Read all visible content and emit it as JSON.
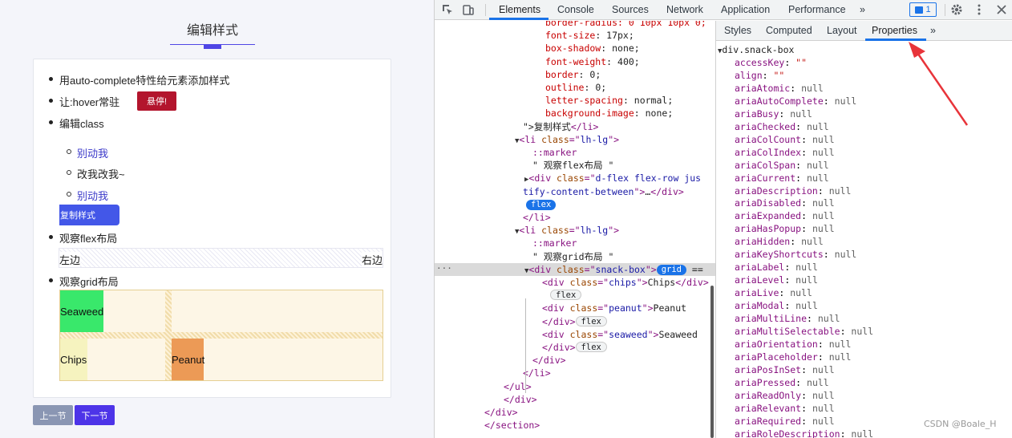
{
  "page": {
    "title": "编辑样式",
    "items": [
      "用auto-complete特性给元素添加样式",
      "让:hover常驻",
      "编辑class",
      "观察flex布局",
      "观察grid布局"
    ],
    "hover_button": "悬停!",
    "sub_items": [
      "别动我",
      "改我改我~",
      "别动我"
    ],
    "snack_button": "复制样式",
    "flex_left": "左边",
    "flex_right": "右边",
    "grid": {
      "seaweed": "Seaweed",
      "chips": "Chips",
      "peanut": "Peanut"
    },
    "prev": "上一节",
    "next": "下一节"
  },
  "devtools": {
    "tabs": [
      "Elements",
      "Console",
      "Sources",
      "Network",
      "Application",
      "Performance",
      "»"
    ],
    "issues_count": "1",
    "side_tabs": [
      "Styles",
      "Computed",
      "Layout",
      "Properties",
      "»"
    ],
    "dom_lines": [
      {
        "parts": [
          [
            "p",
            "border-radius: 0 10px 10px 0;"
          ]
        ]
      },
      {
        "parts": [
          [
            "p",
            "font-size"
          ],
          [
            "pv",
            ": 17px;"
          ]
        ]
      },
      {
        "parts": [
          [
            "p",
            "box-shadow"
          ],
          [
            "pv",
            ": none;"
          ]
        ]
      },
      {
        "parts": [
          [
            "p",
            "font-weight"
          ],
          [
            "pv",
            ": 400;"
          ]
        ]
      },
      {
        "parts": [
          [
            "p",
            "border"
          ],
          [
            "pv",
            ": 0;"
          ]
        ]
      },
      {
        "parts": [
          [
            "p",
            "outline"
          ],
          [
            "pv",
            ": 0;"
          ]
        ]
      },
      {
        "parts": [
          [
            "p",
            "letter-spacing"
          ],
          [
            "pv",
            ": normal;"
          ]
        ]
      },
      {
        "parts": [
          [
            "p",
            "background-image"
          ],
          [
            "pv",
            ": none;"
          ]
        ]
      },
      {
        "parts": [
          [
            "pv",
            "\">复制样式"
          ],
          [
            "t",
            "</li>"
          ]
        ]
      },
      {
        "parts": [
          [
            "tri",
            "▼"
          ],
          [
            "t",
            "<li "
          ],
          [
            "a",
            "class"
          ],
          [
            "t",
            "=\""
          ],
          [
            "v",
            "lh-lg"
          ],
          [
            "t",
            "\">"
          ]
        ]
      },
      {
        "parts": [
          [
            "ps",
            "::marker"
          ]
        ]
      },
      {
        "parts": [
          [
            "pv",
            "\" 观察flex布局 \""
          ]
        ]
      },
      {
        "parts": [
          [
            "tri",
            "▶"
          ],
          [
            "t",
            "<div "
          ],
          [
            "a",
            "class"
          ],
          [
            "t",
            "=\""
          ],
          [
            "v",
            "d-flex flex-row jus"
          ]
        ]
      },
      {
        "parts": [
          [
            "v",
            "tify-content-between"
          ],
          [
            "t",
            "\">"
          ],
          [
            "pv",
            "…"
          ],
          [
            "t",
            "</div>"
          ]
        ]
      },
      {
        "parts": [
          [
            "badge-on",
            "flex"
          ]
        ]
      },
      {
        "parts": [
          [
            "t",
            "</li>"
          ]
        ]
      },
      {
        "parts": [
          [
            "tri",
            "▼"
          ],
          [
            "t",
            "<li "
          ],
          [
            "a",
            "class"
          ],
          [
            "t",
            "=\""
          ],
          [
            "v",
            "lh-lg"
          ],
          [
            "t",
            "\">"
          ]
        ]
      },
      {
        "parts": [
          [
            "ps",
            "::marker"
          ]
        ]
      },
      {
        "parts": [
          [
            "pv",
            "\" 观察grid布局 \""
          ]
        ]
      },
      {
        "parts": [
          [
            "tri",
            "▼"
          ],
          [
            "t",
            "<div "
          ],
          [
            "a",
            "class"
          ],
          [
            "t",
            "=\""
          ],
          [
            "v",
            "snack-box"
          ],
          [
            "t",
            "\">"
          ],
          [
            "badge-on",
            "grid"
          ],
          [
            "pv",
            " =="
          ]
        ]
      },
      {
        "parts": [
          [
            "t",
            "<div "
          ],
          [
            "a",
            "class"
          ],
          [
            "t",
            "=\""
          ],
          [
            "v",
            "chips"
          ],
          [
            "t",
            "\">"
          ],
          [
            "pv",
            "Chips"
          ],
          [
            "t",
            "</div>"
          ]
        ]
      },
      {
        "parts": [
          [
            "badge-off",
            "flex"
          ]
        ]
      },
      {
        "parts": [
          [
            "t",
            "<div "
          ],
          [
            "a",
            "class"
          ],
          [
            "t",
            "=\""
          ],
          [
            "v",
            "peanut"
          ],
          [
            "t",
            "\">"
          ],
          [
            "pv",
            "Peanut"
          ]
        ]
      },
      {
        "parts": [
          [
            "t",
            "</div>"
          ],
          [
            "badge-off",
            "flex"
          ]
        ]
      },
      {
        "parts": [
          [
            "t",
            "<div "
          ],
          [
            "a",
            "class"
          ],
          [
            "t",
            "=\""
          ],
          [
            "v",
            "seaweed"
          ],
          [
            "t",
            "\">"
          ],
          [
            "pv",
            "Seaweed"
          ]
        ]
      },
      {
        "parts": [
          [
            "t",
            "</div>"
          ],
          [
            "badge-off",
            "flex"
          ]
        ]
      },
      {
        "parts": [
          [
            "t",
            "</div>"
          ]
        ]
      },
      {
        "parts": [
          [
            "t",
            "</li>"
          ]
        ]
      },
      {
        "parts": [
          [
            "t",
            "</ul>"
          ]
        ]
      },
      {
        "parts": [
          [
            "t",
            "</div>"
          ]
        ]
      },
      {
        "parts": [
          [
            "t",
            "</div>"
          ]
        ]
      },
      {
        "parts": [
          [
            "t",
            "</section>"
          ]
        ]
      }
    ],
    "dom_indent": [
      138,
      138,
      138,
      138,
      138,
      138,
      138,
      138,
      110,
      100,
      122,
      122,
      112,
      110,
      114,
      110,
      100,
      122,
      122,
      112,
      134,
      144,
      134,
      134,
      134,
      134,
      122,
      110,
      86,
      86,
      62,
      62
    ],
    "dom_selected": 19,
    "props_head": "div.snack-box",
    "props": [
      [
        "accessKey",
        "\"\"",
        "s"
      ],
      [
        "align",
        "\"\"",
        "s"
      ],
      [
        "ariaAtomic",
        "null",
        "n"
      ],
      [
        "ariaAutoComplete",
        "null",
        "n"
      ],
      [
        "ariaBusy",
        "null",
        "n"
      ],
      [
        "ariaChecked",
        "null",
        "n"
      ],
      [
        "ariaColCount",
        "null",
        "n"
      ],
      [
        "ariaColIndex",
        "null",
        "n"
      ],
      [
        "ariaColSpan",
        "null",
        "n"
      ],
      [
        "ariaCurrent",
        "null",
        "n"
      ],
      [
        "ariaDescription",
        "null",
        "n"
      ],
      [
        "ariaDisabled",
        "null",
        "n"
      ],
      [
        "ariaExpanded",
        "null",
        "n"
      ],
      [
        "ariaHasPopup",
        "null",
        "n"
      ],
      [
        "ariaHidden",
        "null",
        "n"
      ],
      [
        "ariaKeyShortcuts",
        "null",
        "n"
      ],
      [
        "ariaLabel",
        "null",
        "n"
      ],
      [
        "ariaLevel",
        "null",
        "n"
      ],
      [
        "ariaLive",
        "null",
        "n"
      ],
      [
        "ariaModal",
        "null",
        "n"
      ],
      [
        "ariaMultiLine",
        "null",
        "n"
      ],
      [
        "ariaMultiSelectable",
        "null",
        "n"
      ],
      [
        "ariaOrientation",
        "null",
        "n"
      ],
      [
        "ariaPlaceholder",
        "null",
        "n"
      ],
      [
        "ariaPosInSet",
        "null",
        "n"
      ],
      [
        "ariaPressed",
        "null",
        "n"
      ],
      [
        "ariaReadOnly",
        "null",
        "n"
      ],
      [
        "ariaRelevant",
        "null",
        "n"
      ],
      [
        "ariaRequired",
        "null",
        "n"
      ],
      [
        "ariaRoleDescription",
        "null",
        "n"
      ]
    ],
    "watermark": "CSDN @Boale_H",
    "accent": "#1a73e8",
    "arrow_color": "#e8343a"
  }
}
